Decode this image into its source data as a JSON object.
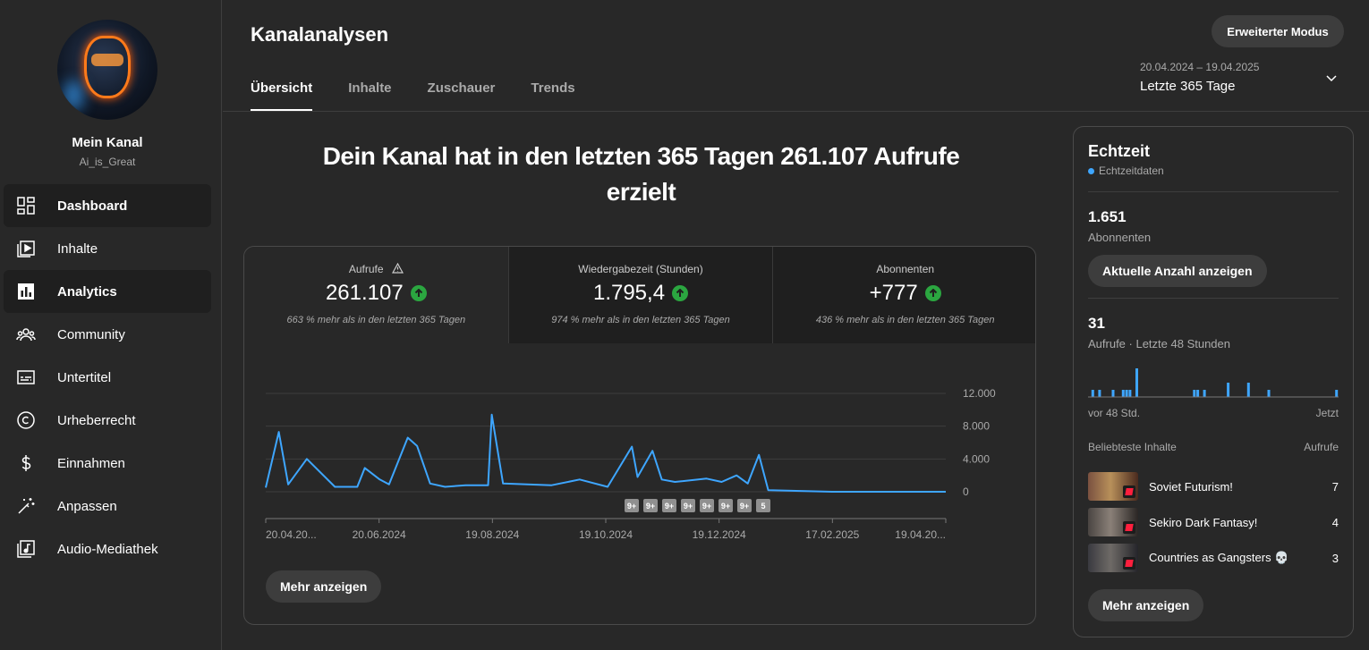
{
  "sidebar": {
    "channel_name": "Mein Kanal",
    "channel_handle": "Ai_is_Great",
    "items": [
      {
        "label": "Dashboard",
        "icon": "dashboard-icon",
        "active": true
      },
      {
        "label": "Inhalte",
        "icon": "content-icon",
        "active": false
      },
      {
        "label": "Analytics",
        "icon": "analytics-icon",
        "active": true
      },
      {
        "label": "Community",
        "icon": "community-icon",
        "active": false
      },
      {
        "label": "Untertitel",
        "icon": "subtitles-icon",
        "active": false
      },
      {
        "label": "Urheberrecht",
        "icon": "copyright-icon",
        "active": false
      },
      {
        "label": "Einnahmen",
        "icon": "dollar-icon",
        "active": false
      },
      {
        "label": "Anpassen",
        "icon": "magic-wand-icon",
        "active": false
      },
      {
        "label": "Audio-Mediathek",
        "icon": "music-library-icon",
        "active": false
      }
    ]
  },
  "header": {
    "title": "Kanalanalysen",
    "advanced_mode": "Erweiterter Modus",
    "tabs": [
      "Übersicht",
      "Inhalte",
      "Zuschauer",
      "Trends"
    ],
    "active_tab": "Übersicht",
    "date_range": "20.04.2024 – 19.04.2025",
    "date_label": "Letzte 365 Tage"
  },
  "overview": {
    "headline": "Dein Kanal hat in den letzten 365 Tagen 261.107 Aufrufe erzielt",
    "metrics": [
      {
        "label": "Aufrufe",
        "value": "261.107",
        "sub": "663 % mehr als in den letzten 365 Tagen",
        "warn": true
      },
      {
        "label": "Wiedergabezeit (Stunden)",
        "value": "1.795,4",
        "sub": "974 % mehr als in den letzten 365 Tagen",
        "warn": false
      },
      {
        "label": "Abonnenten",
        "value": "+777",
        "sub": "436 % mehr als in den letzten 365 Tagen",
        "warn": false
      }
    ],
    "more_button": "Mehr anzeigen"
  },
  "chart_data": {
    "type": "line",
    "title": "",
    "xlabel": "",
    "ylabel": "",
    "ylim": [
      0,
      12000
    ],
    "y_ticks": [
      "12.000",
      "8.000",
      "4.000",
      "0"
    ],
    "x_ticks": [
      "20.04.20...",
      "20.06.2024",
      "19.08.2024",
      "19.10.2024",
      "19.12.2024",
      "17.02.2025",
      "19.04.20..."
    ],
    "series_color": "#3ea6ff",
    "markers": [
      "9+",
      "9+",
      "9+",
      "9+",
      "9+",
      "9+",
      "9+",
      "5"
    ],
    "x": [
      "2024-04-20",
      "2024-04-27",
      "2024-05-02",
      "2024-05-12",
      "2024-05-27",
      "2024-06-08",
      "2024-06-12",
      "2024-06-20",
      "2024-06-25",
      "2024-07-05",
      "2024-07-10",
      "2024-07-17",
      "2024-07-25",
      "2024-08-05",
      "2024-08-17",
      "2024-08-19",
      "2024-08-25",
      "2024-09-20",
      "2024-10-05",
      "2024-10-20",
      "2024-11-02",
      "2024-11-05",
      "2024-11-13",
      "2024-11-18",
      "2024-11-25",
      "2024-12-12",
      "2024-12-20",
      "2024-12-28",
      "2025-01-03",
      "2025-01-09",
      "2025-01-14",
      "2025-02-17",
      "2025-04-19"
    ],
    "values": [
      500,
      7300,
      900,
      4000,
      600,
      600,
      2900,
      1500,
      900,
      6600,
      5600,
      1000,
      600,
      800,
      800,
      9400,
      1000,
      800,
      1500,
      600,
      5500,
      1800,
      5000,
      1500,
      1200,
      1600,
      1200,
      2000,
      1000,
      4500,
      200,
      0,
      0
    ]
  },
  "realtime": {
    "title": "Echtzeit",
    "subtitle": "Echtzeitdaten",
    "subscribers": "1.651",
    "subscribers_label": "Abonnenten",
    "subscribers_button": "Aktuelle Anzahl anzeigen",
    "views": "31",
    "views_label": "Aufrufe · Letzte 48 Stunden",
    "axis_left": "vor 48 Std.",
    "axis_right": "Jetzt",
    "bars": [
      0,
      1,
      0,
      1,
      0,
      0,
      0,
      1,
      0,
      0,
      1,
      1,
      1,
      0,
      4,
      0,
      0,
      0,
      0,
      0,
      0,
      0,
      0,
      0,
      0,
      0,
      0,
      0,
      0,
      0,
      0,
      1,
      1,
      0,
      1,
      0,
      0,
      0,
      0,
      0,
      0,
      2,
      0,
      0,
      0,
      0,
      0,
      2,
      0,
      0,
      0,
      0,
      0,
      1,
      0,
      0,
      0,
      0,
      0,
      0,
      0,
      0,
      0,
      0,
      0,
      0,
      0,
      0,
      0,
      0,
      0,
      0,
      0,
      1
    ],
    "top_header": "Beliebteste Inhalte",
    "top_value_header": "Aufrufe",
    "top_items": [
      {
        "title": "Soviet Futurism!",
        "value": "7"
      },
      {
        "title": "Sekiro Dark Fantasy!",
        "value": "4"
      },
      {
        "title": "Countries as Gangsters 💀",
        "value": "3"
      }
    ],
    "more_button": "Mehr anzeigen"
  }
}
